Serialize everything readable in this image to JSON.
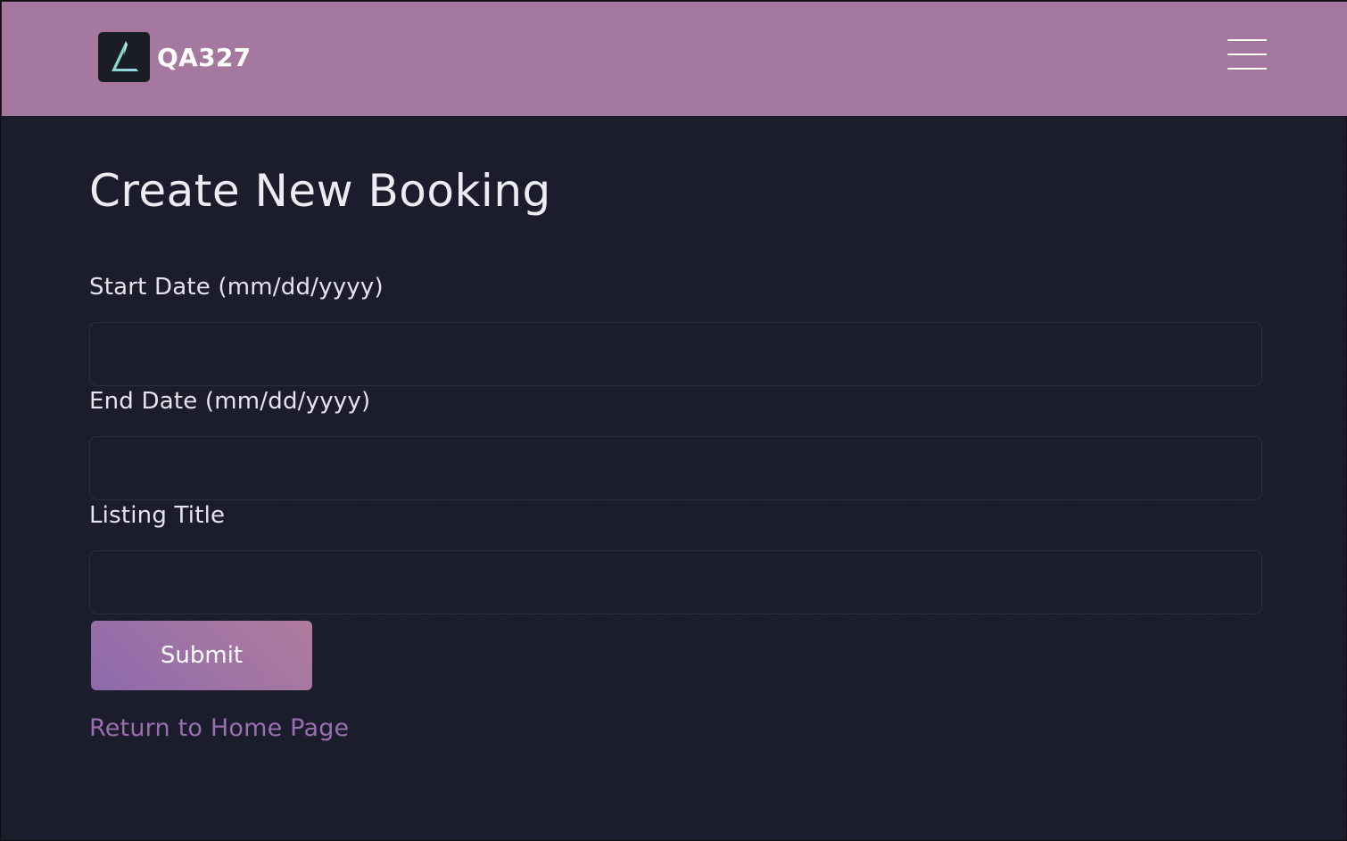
{
  "navbar": {
    "brand_name": "QA327",
    "logo_icon": "triangle-logo-icon",
    "menu_icon": "hamburger-menu-icon"
  },
  "page": {
    "title": "Create New Booking"
  },
  "form": {
    "fields": [
      {
        "label": "Start Date (mm/dd/yyyy)",
        "value": "",
        "placeholder": ""
      },
      {
        "label": "End Date (mm/dd/yyyy)",
        "value": "",
        "placeholder": ""
      },
      {
        "label": "Listing Title",
        "value": "",
        "placeholder": ""
      }
    ],
    "submit_label": "Submit"
  },
  "links": {
    "return_home": "Return to Home Page"
  },
  "colors": {
    "navbar_bg": "#a5789f",
    "page_bg": "#1b1c2c",
    "link": "#9a6fb0",
    "button_gradient_start": "#8e6aac",
    "button_gradient_end": "#b07c9e"
  }
}
